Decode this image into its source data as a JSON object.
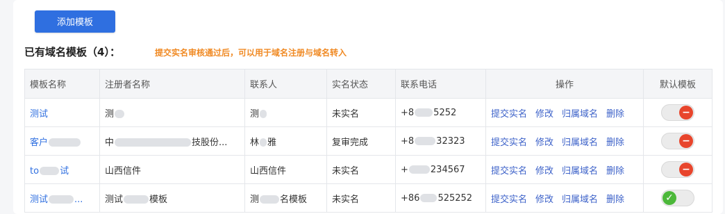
{
  "toolbar": {
    "add_label": "添加模板"
  },
  "section": {
    "title": "已有域名模板（4）：",
    "hint": "提交实名审核通过后，可以用于域名注册与域名转入"
  },
  "table": {
    "headers": [
      "模板名称",
      "注册者名称",
      "联系人",
      "实名状态",
      "联系电话",
      "操作",
      "默认模板"
    ],
    "actions": [
      "提交实名",
      "修改",
      "归属域名",
      "删除"
    ],
    "rows": [
      {
        "name": "测试",
        "registrant": "测",
        "contact": "测",
        "status": "未实名",
        "phone_pre": "+8",
        "phone_post": "5252",
        "default_on": false
      },
      {
        "name": "客户",
        "registrant": "中",
        "registrant2": "技股份...",
        "contact": "林",
        "contact2": "雅",
        "status": "复审完成",
        "phone_pre": "+8",
        "phone_post": "32323",
        "default_on": false
      },
      {
        "name": "to",
        "name2": "试",
        "registrant": "山西信件",
        "contact": "山西信件",
        "status": "未实名",
        "phone_pre": "+",
        "phone_post": "234567",
        "default_on": false
      },
      {
        "name": "测试",
        "name2": "...",
        "registrant": "测试",
        "registrant2": "模板",
        "contact": "测",
        "contact2": "名模板",
        "status": "未实名",
        "phone_pre": "+86",
        "phone_post": "525252",
        "default_on": true
      }
    ]
  },
  "icons": {
    "off": "minus-icon",
    "on": "check-icon",
    "off_color": "#e8452c",
    "on_color": "#4cb83a"
  }
}
